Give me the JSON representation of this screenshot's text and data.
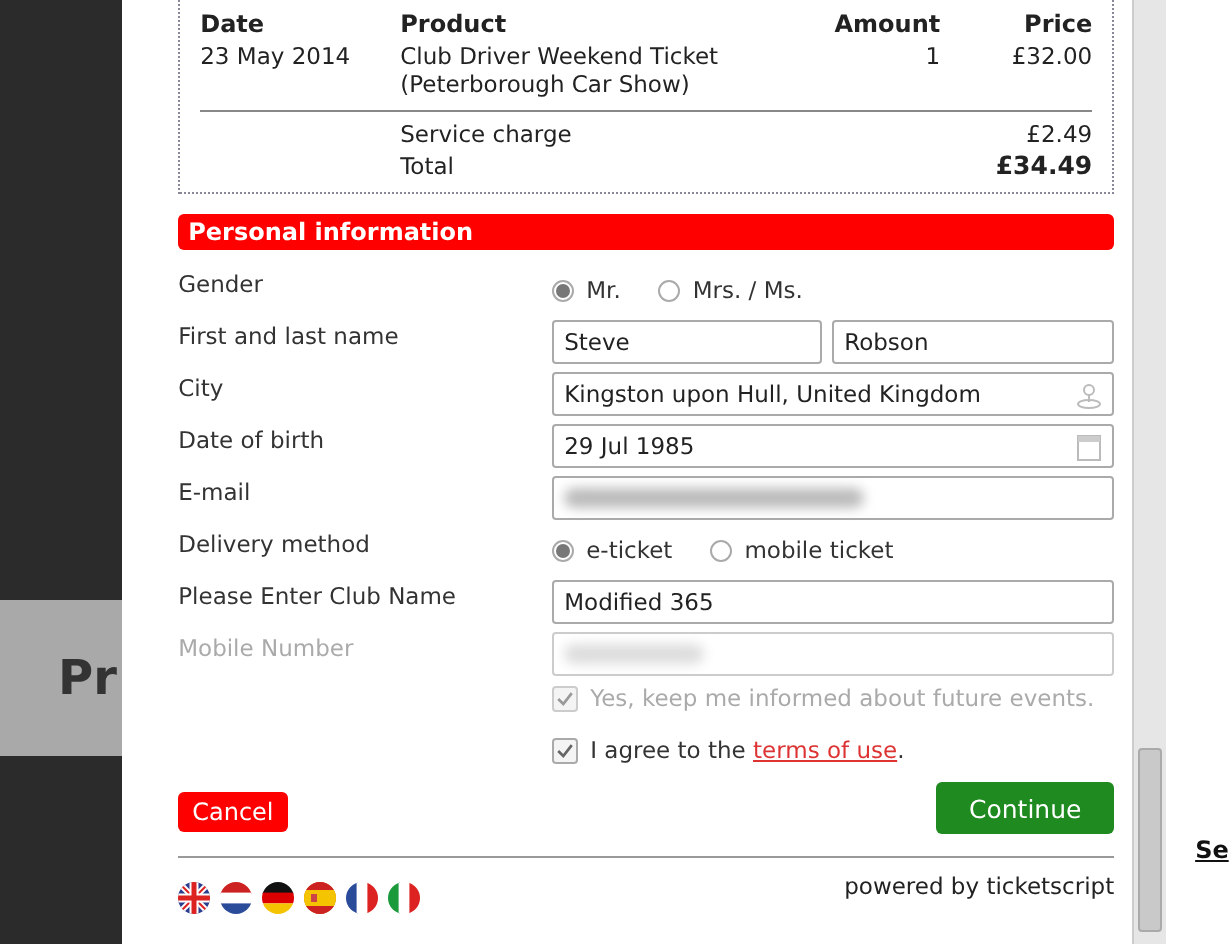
{
  "background": {
    "heading": "Pr",
    "link": "Se"
  },
  "order": {
    "columns": [
      "Date",
      "Product",
      "Amount",
      "Price"
    ],
    "rows": [
      {
        "date": "23 May 2014",
        "product": [
          "Club Driver Weekend Ticket",
          "(Peterborough Car Show)"
        ],
        "amount": "1",
        "price": "£32.00"
      }
    ],
    "service_charge": {
      "label": "Service charge",
      "price": "£2.49"
    },
    "total": {
      "label": "Total",
      "price": "£34.49"
    }
  },
  "section_title": "Personal information",
  "fields": [
    {
      "kind": "radio",
      "label": "Gender",
      "disabled": false,
      "options": [
        {
          "label": "Mr.",
          "selected": true
        },
        {
          "label": "Mrs. / Ms.",
          "selected": false
        }
      ]
    },
    {
      "kind": "name",
      "label": "First and last name",
      "disabled": false,
      "values": [
        "Steve",
        "Robson"
      ]
    },
    {
      "kind": "place",
      "label": "City",
      "disabled": false,
      "value": "Kingston upon Hull, United Kingdom"
    },
    {
      "kind": "date",
      "label": "Date of birth",
      "disabled": false,
      "value": "29 Jul 1985"
    },
    {
      "kind": "hidden",
      "label": "E-mail",
      "disabled": false
    },
    {
      "kind": "radio",
      "label": "Delivery method",
      "disabled": false,
      "options": [
        {
          "label": "e-ticket",
          "selected": true
        },
        {
          "label": "mobile ticket",
          "selected": false
        }
      ]
    },
    {
      "kind": "text",
      "label": "Please Enter Club Name",
      "disabled": false,
      "value": "Modified 365"
    },
    {
      "kind": "hidden",
      "label": "Mobile Number",
      "disabled": true
    }
  ],
  "checkboxes": [
    {
      "text": "Yes, keep me informed about future events.",
      "checked": true,
      "disabled": true
    },
    {
      "text": "I agree to the ",
      "link": "terms of use",
      "after": ".",
      "checked": true,
      "disabled": false
    }
  ],
  "buttons": {
    "cancel": "Cancel",
    "continue": "Continue"
  },
  "languages": [
    {
      "kind": "uk"
    },
    {
      "kind": "nl"
    },
    {
      "kind": "de"
    },
    {
      "kind": "es"
    },
    {
      "kind": "fr"
    },
    {
      "kind": "it"
    }
  ],
  "footer": "powered by ticketscript"
}
